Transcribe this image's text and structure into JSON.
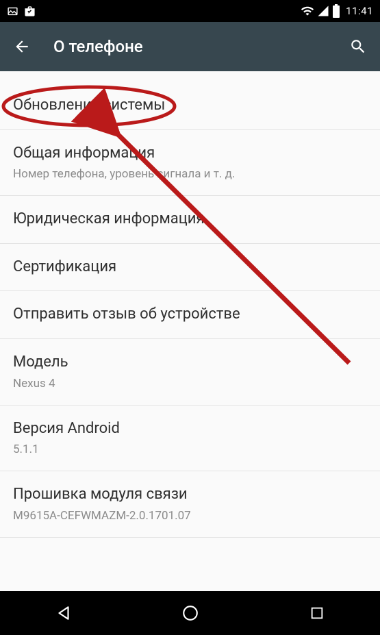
{
  "statusBar": {
    "time": "11:41"
  },
  "appBar": {
    "title": "О телефоне"
  },
  "items": [
    {
      "title": "Обновление системы",
      "subtitle": null
    },
    {
      "title": "Общая информация",
      "subtitle": "Номер телефона, уровень сигнала и т. д."
    },
    {
      "title": "Юридическая информация",
      "subtitle": null
    },
    {
      "title": "Сертификация",
      "subtitle": null
    },
    {
      "title": "Отправить отзыв об устройстве",
      "subtitle": null
    },
    {
      "title": "Модель",
      "subtitle": "Nexus 4"
    },
    {
      "title": "Версия Android",
      "subtitle": "5.1.1"
    },
    {
      "title": "Прошивка модуля связи",
      "subtitle": "M9615A-CEFWMAZM-2.0.1701.07"
    }
  ]
}
